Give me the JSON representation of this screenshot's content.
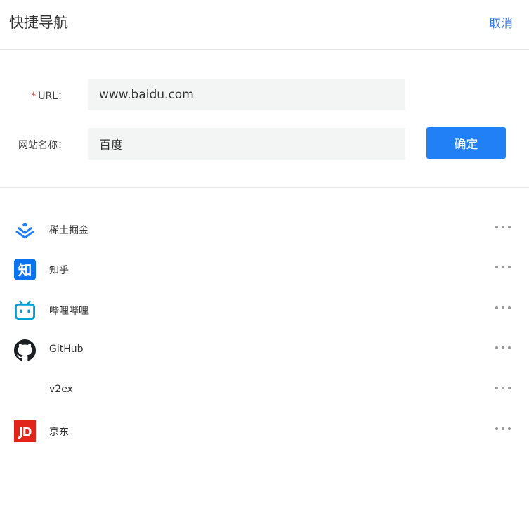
{
  "header": {
    "title": "快捷导航",
    "cancel_label": "取消"
  },
  "form": {
    "url_required_mark": "*",
    "url_label": "URL：",
    "url_value": "www.baidu.com",
    "name_label": "网站名称：",
    "name_value": "百度",
    "submit_label": "确定"
  },
  "sites": [
    {
      "name": "稀土掘金",
      "icon": "juejin-icon"
    },
    {
      "name": "知乎",
      "icon": "zhihu-icon"
    },
    {
      "name": "哔哩哔哩",
      "icon": "bilibili-icon"
    },
    {
      "name": "GitHub",
      "icon": "github-icon"
    },
    {
      "name": "v2ex",
      "icon": ""
    },
    {
      "name": "京东",
      "icon": "jd-icon"
    }
  ],
  "colors": {
    "accent": "#2180f5",
    "link": "#3a7ee8",
    "required": "#e2453c",
    "input_bg": "#f3f4f4"
  }
}
